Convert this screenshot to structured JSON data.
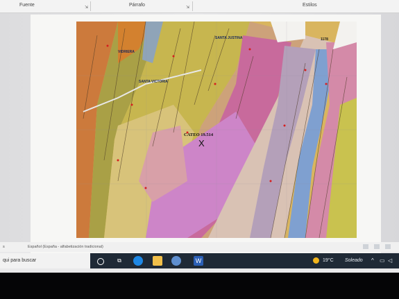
{
  "ribbon": {
    "groups": [
      "Fuente",
      "Párrafo",
      "Estilos"
    ]
  },
  "map": {
    "main_label": "CATEO 19.514",
    "places": [
      "SANTA VICTORIA",
      "VIDRIERA",
      "SANTA JUSTINA"
    ],
    "elevation": "1178",
    "marker": "X"
  },
  "statusbar": {
    "page_info": "s",
    "language": "Español (España - alfabetización tradicional)"
  },
  "taskbar": {
    "search_placeholder": "qui para buscar",
    "word_icon_letter": "W"
  },
  "tray": {
    "temperature": "19°C",
    "weather": "Soleado",
    "weather_icon": "sun-icon"
  }
}
